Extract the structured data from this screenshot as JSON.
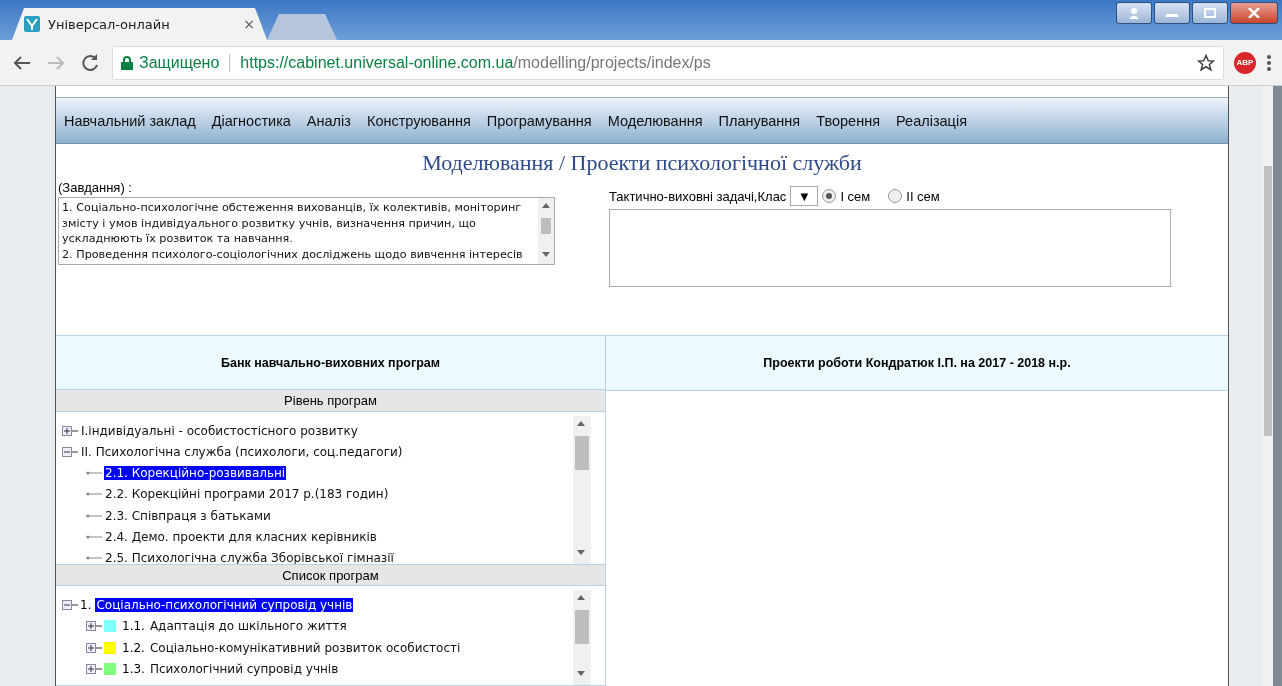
{
  "browser": {
    "tabs": [
      {
        "title": "Універсал-онлайн",
        "close": "×",
        "selected": true
      },
      {
        "selected": false
      }
    ],
    "security": "Защищено",
    "url_host": "https://cabinet.universal-online.com.ua",
    "url_path": "/modelling/projects/index/ps",
    "extension_badge": "ABP"
  },
  "nav": {
    "items": [
      "Навчальний заклад",
      "Діагностика",
      "Аналіз",
      "Конструювання",
      "Програмування",
      "Моделювання",
      "Планування",
      "Творення",
      "Реалізація"
    ]
  },
  "page_title": "Моделювання / Проекти психологічної служби",
  "tasks": {
    "label": "(Завдання) :",
    "lines": [
      "1. Соціально-психологічне обстеження вихованців, їх колективів, моніторинг змісту і умов індивідуального розвитку учнів, визначення причин, що ускладнюють їх розвиток та навчання.",
      "2. Проведення психолого-соціологічних досліджень щодо вивчення інтересів"
    ]
  },
  "goals": {
    "label": "Тактично-виховні задачі,Клас",
    "dropdown": "▼",
    "radios": [
      {
        "label": "I сем",
        "selected": true
      },
      {
        "label": "II сем",
        "selected": false
      }
    ]
  },
  "left_panel": {
    "title": "Банк навчально-виховних програм",
    "levels": {
      "title": "Рівень програм",
      "tree": [
        {
          "label": "I.індивідуальні - особистостісного розвитку",
          "expanded": false,
          "selected": false
        },
        {
          "label": "II. Психологічна служба (психологи, соц.педагоги)",
          "expanded": true,
          "selected": false,
          "children": [
            {
              "label": "2.1. Корекційно-розвивальні",
              "selected": true
            },
            {
              "label": "2.2. Корекційні програми 2017 р.(183 годин)",
              "selected": false
            },
            {
              "label": "2.3. Співпраця з батьками",
              "selected": false
            },
            {
              "label": "2.4. Демо. проекти для класних керівників",
              "selected": false
            },
            {
              "label": "2.5. Психологічна служба Зборівської гімназії",
              "selected": false
            }
          ]
        }
      ]
    },
    "list": {
      "title": "Список програм",
      "tree": [
        {
          "number": "1.",
          "label": "Соціально-психологічний супровід учнів",
          "expanded": true,
          "selected": true,
          "children": [
            {
              "number": "1.1.",
              "label": "Адаптація до шкільного життя",
              "expanded": false,
              "selected": false,
              "color": "#80ffff"
            },
            {
              "number": "1.2.",
              "label": "Соціально-комунікативний розвиток особистості",
              "expanded": false,
              "selected": false,
              "color": "#ffff00"
            },
            {
              "number": "1.3.",
              "label": "Психологічний супровід учнів",
              "expanded": false,
              "selected": false,
              "color": "#80ff80"
            }
          ]
        }
      ]
    }
  },
  "right_panel": {
    "title": "Проекти роботи Кондратюк І.П. на 2017 - 2018 н.р."
  }
}
